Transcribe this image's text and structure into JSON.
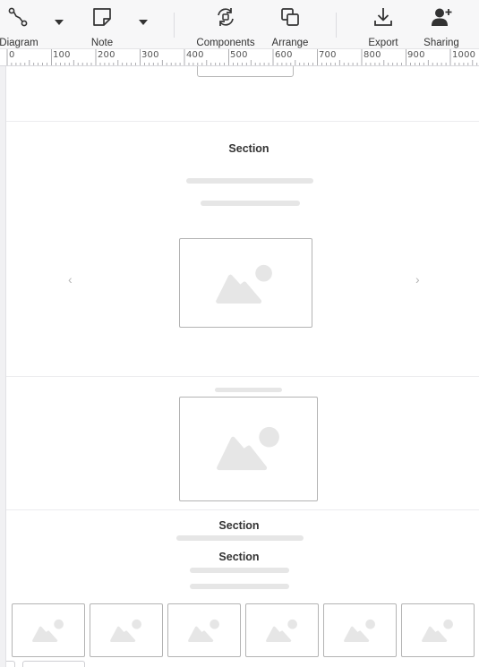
{
  "toolbar": {
    "diagram_label": "Diagram",
    "note_label": "Note",
    "components_label": "Components",
    "arrange_label": "Arrange",
    "export_label": "Export",
    "sharing_label": "Sharing"
  },
  "ruler": {
    "ticks": [
      "0",
      "100",
      "200",
      "300",
      "400",
      "500",
      "600",
      "700",
      "800",
      "900",
      "1000"
    ]
  },
  "canvas": {
    "carousel": {
      "title": "Section",
      "prev_arrow": "‹",
      "next_arrow": "›"
    },
    "stack": {
      "title_1": "Section",
      "title_2": "Section"
    },
    "thumbnails": 6
  },
  "colors": {
    "toolbar_bg": "#f7f7f8",
    "placeholder_gray": "#e6e6e6",
    "border_gray": "#b3b3b3"
  }
}
